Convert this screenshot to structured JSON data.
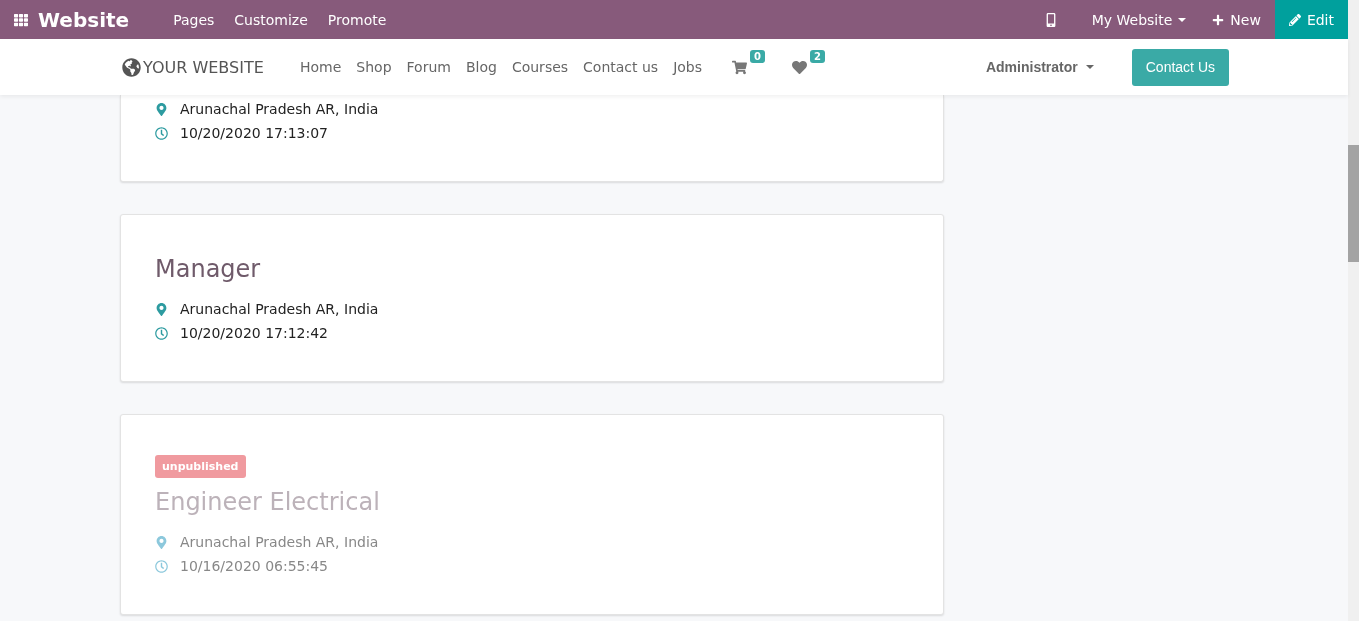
{
  "topbar": {
    "app": "Website",
    "menus": [
      "Pages",
      "Customize",
      "Promote"
    ],
    "website": "My Website",
    "new": "New",
    "edit": "Edit"
  },
  "navbar": {
    "logo": "YOUR WEBSITE",
    "links": [
      "Home",
      "Shop",
      "Forum",
      "Blog",
      "Courses",
      "Contact us",
      "Jobs"
    ],
    "cart_count": "0",
    "wishlist_count": "2",
    "user": "Administrator",
    "cta": "Contact Us"
  },
  "jobs": [
    {
      "location": "Arunachal Pradesh AR, India",
      "date": "10/20/2020 17:13:07",
      "published": true
    },
    {
      "title": "Manager",
      "location": "Arunachal Pradesh AR, India",
      "date": "10/20/2020 17:12:42",
      "published": true
    },
    {
      "title": "Engineer Electrical",
      "badge": "unpublished",
      "location": "Arunachal Pradesh AR, India",
      "date": "10/16/2020 06:55:45",
      "published": false
    }
  ]
}
